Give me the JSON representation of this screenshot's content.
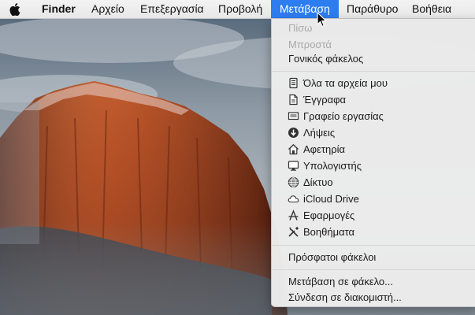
{
  "menubar": {
    "apple_icon": "apple-logo-icon",
    "items": [
      {
        "label": "Finder"
      },
      {
        "label": "Αρχείο"
      },
      {
        "label": "Επεξεργασία"
      },
      {
        "label": "Προβολή"
      },
      {
        "label": "Μετάβαση"
      },
      {
        "label": "Παράθυρο"
      },
      {
        "label": "Βοήθεια"
      }
    ],
    "active_color": "#2d7cf0"
  },
  "go_menu": {
    "items": [
      {
        "label": "Πίσω",
        "enabled": false
      },
      {
        "label": "Μπροστά",
        "enabled": false
      },
      {
        "label": "Γονικός φάκελος",
        "enabled": true
      },
      {
        "label": "Όλα τα αρχεία μου",
        "icon": "all-files-icon"
      },
      {
        "label": "Έγγραφα",
        "icon": "documents-icon"
      },
      {
        "label": "Γραφείο εργασίας",
        "icon": "desktop-icon"
      },
      {
        "label": "Λήψεις",
        "icon": "downloads-icon"
      },
      {
        "label": "Αφετηρία",
        "icon": "home-icon"
      },
      {
        "label": "Υπολογιστής",
        "icon": "computer-icon"
      },
      {
        "label": "Δίκτυο",
        "icon": "network-icon"
      },
      {
        "label": "iCloud Drive",
        "icon": "icloud-icon"
      },
      {
        "label": "Εφαρμογές",
        "icon": "applications-icon"
      },
      {
        "label": "Βοηθήματα",
        "icon": "utilities-icon"
      },
      {
        "label": "Πρόσφατοι φάκελοι"
      },
      {
        "label": "Μετάβαση σε φάκελο..."
      },
      {
        "label": "Σύνδεση σε διακομιστή..."
      }
    ]
  }
}
